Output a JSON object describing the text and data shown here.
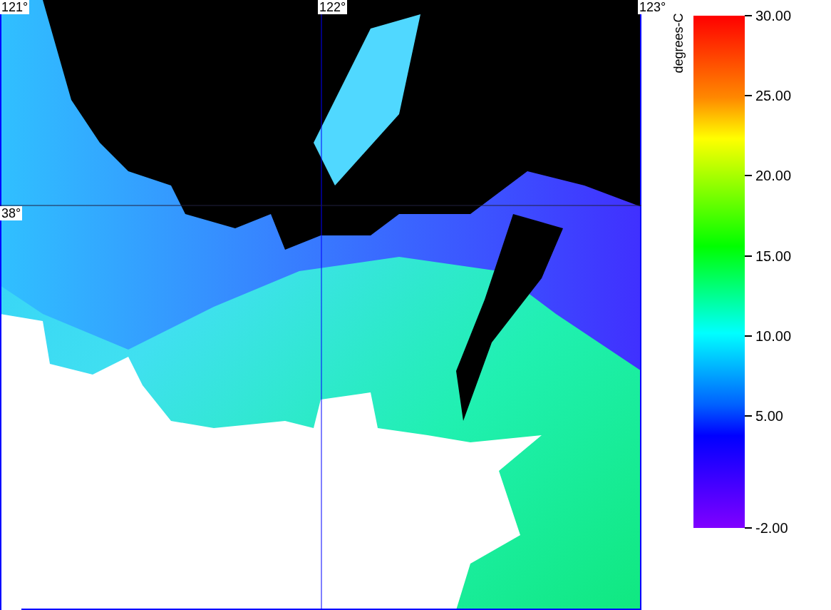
{
  "map": {
    "lon_labels": [
      "121°",
      "122°",
      "123°"
    ],
    "lat_labels": [
      "38°"
    ]
  },
  "legend": {
    "title": "degrees-C",
    "ticks": [
      {
        "label": "30.00",
        "level": 1
      },
      {
        "label": "25.00",
        "level": 0.84375
      },
      {
        "label": "20.00",
        "level": 0.6875
      },
      {
        "label": "15.00",
        "level": 0.53125
      },
      {
        "label": "10.00",
        "level": 0.375
      },
      {
        "label": "5.00",
        "level": 0.21875
      },
      {
        "label": "-2.00",
        "level": 0
      }
    ]
  }
}
